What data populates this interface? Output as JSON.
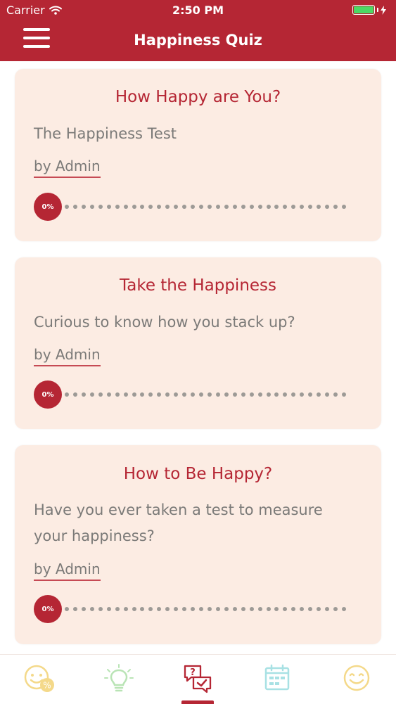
{
  "status_bar": {
    "carrier": "Carrier",
    "time": "2:50 PM",
    "wifi_icon": "wifi-icon",
    "battery_icon": "battery-icon",
    "battery_color": "#4cd964"
  },
  "header": {
    "title": "Happiness Quiz",
    "menu_icon": "hamburger-menu-icon",
    "background_color": "#b52634"
  },
  "quizzes": [
    {
      "title": "How Happy are You?",
      "subtitle": "The Happiness Test",
      "author": "by Admin",
      "progress_label": "0%",
      "progress": 0
    },
    {
      "title": "Take the Happiness",
      "subtitle": "Curious to know how you stack up?",
      "author": "by Admin",
      "progress_label": "0%",
      "progress": 0
    },
    {
      "title": "How to Be Happy?",
      "subtitle": "Have you ever taken a test to measure your happiness?",
      "author": "by Admin",
      "progress_label": "0%",
      "progress": 0
    }
  ],
  "tabbar": {
    "tabs": [
      {
        "icon": "smiley-percent-icon",
        "active": false
      },
      {
        "icon": "lightbulb-icon",
        "active": false
      },
      {
        "icon": "quiz-icon",
        "active": true
      },
      {
        "icon": "calendar-icon",
        "active": false
      },
      {
        "icon": "smiley-icon",
        "active": false
      }
    ],
    "active_color": "#b52634"
  }
}
